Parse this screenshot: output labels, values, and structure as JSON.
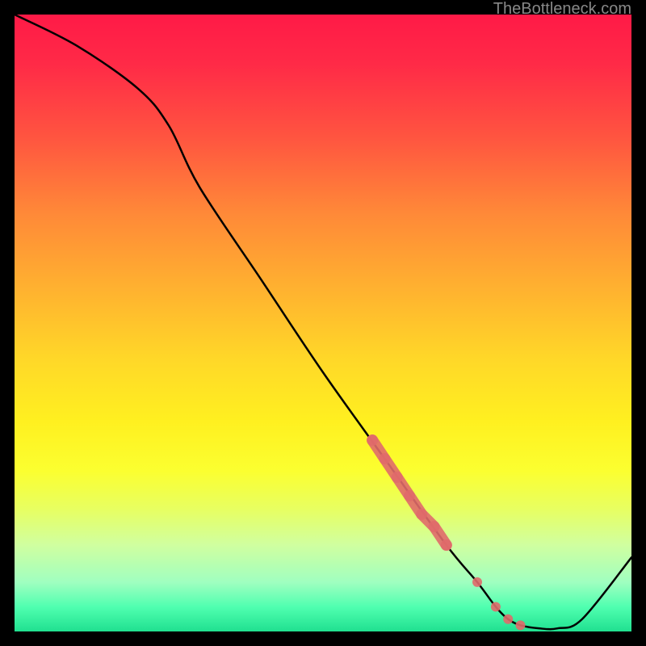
{
  "watermark": "TheBottleneck.com",
  "chart_data": {
    "type": "line",
    "title": "",
    "xlabel": "",
    "ylabel": "",
    "xlim": [
      0,
      100
    ],
    "ylim": [
      0,
      100
    ],
    "grid": false,
    "legend": false,
    "series": [
      {
        "name": "curve",
        "color": "#000000",
        "x": [
          0,
          10,
          20,
          25,
          30,
          40,
          50,
          60,
          70,
          75,
          78,
          80,
          82,
          85,
          88,
          92,
          100
        ],
        "values": [
          100,
          95,
          88,
          82,
          72,
          57,
          42,
          28,
          14,
          8,
          4,
          2,
          1,
          0.5,
          0.5,
          2,
          12
        ]
      }
    ],
    "markers": {
      "name": "highlight-segment",
      "color": "#e06a6a",
      "type": "thick-dots",
      "x": [
        58,
        60,
        62,
        64,
        66,
        68,
        70,
        75,
        78,
        80,
        82
      ],
      "values": [
        31,
        28,
        25,
        22,
        19,
        17,
        14,
        8,
        4,
        2,
        1
      ]
    }
  }
}
